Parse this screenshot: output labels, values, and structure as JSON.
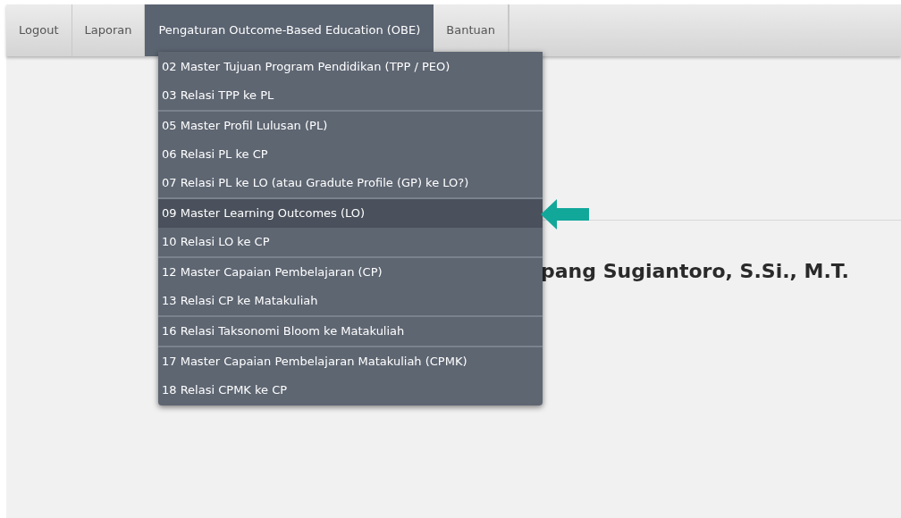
{
  "nav_tabs": [
    {
      "label": "Logout",
      "selected": false
    },
    {
      "label": "Laporan",
      "selected": false
    },
    {
      "label": "Pengaturan Outcome-Based Education (OBE)",
      "selected": true
    },
    {
      "label": "Bantuan",
      "selected": false
    }
  ],
  "dropdown_menu": {
    "groups": [
      [
        {
          "label": "02 Master Tujuan Program Pendidikan (TPP / PEO)",
          "selected": false
        },
        {
          "label": "03 Relasi TPP ke PL",
          "selected": false
        }
      ],
      [
        {
          "label": "05 Master Profil Lulusan (PL)",
          "selected": false
        },
        {
          "label": "06 Relasi PL ke CP",
          "selected": false
        },
        {
          "label": "07 Relasi PL ke LO (atau Gradute Profile (GP) ke LO?)",
          "selected": false
        }
      ],
      [
        {
          "label": "09 Master Learning Outcomes (LO)",
          "selected": true
        },
        {
          "label": "10 Relasi LO ke CP",
          "selected": false
        }
      ],
      [
        {
          "label": "12 Master Capaian Pembelajaran (CP)",
          "selected": false
        },
        {
          "label": "13 Relasi CP ke Matakuliah",
          "selected": false
        }
      ],
      [
        {
          "label": "16 Relasi Taksonomi Bloom ke Matakuliah",
          "selected": false
        }
      ],
      [
        {
          "label": "17 Master Capaian Pembelajaran Matakuliah (CPMK)",
          "selected": false
        },
        {
          "label": "18 Relasi CPMK ke CP",
          "selected": false
        }
      ]
    ]
  },
  "heading": "pang Sugiantoro, S.Si., M.T."
}
